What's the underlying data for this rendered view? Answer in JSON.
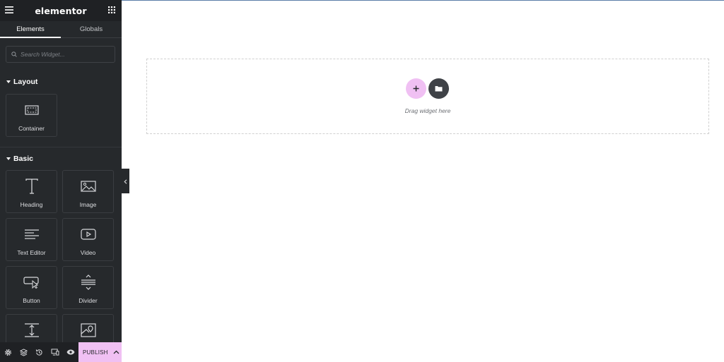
{
  "app": {
    "brand": "elementor"
  },
  "tabs": [
    {
      "label": "Elements",
      "active": true
    },
    {
      "label": "Globals",
      "active": false
    }
  ],
  "search": {
    "placeholder": "Search Widget..."
  },
  "sections": {
    "layout": {
      "title": "Layout",
      "widgets": [
        {
          "label": "Container",
          "icon": "container-icon"
        }
      ]
    },
    "basic": {
      "title": "Basic",
      "widgets": [
        {
          "label": "Heading",
          "icon": "heading-icon"
        },
        {
          "label": "Image",
          "icon": "image-icon"
        },
        {
          "label": "Text Editor",
          "icon": "text-editor-icon"
        },
        {
          "label": "Video",
          "icon": "video-icon"
        },
        {
          "label": "Button",
          "icon": "button-icon"
        },
        {
          "label": "Divider",
          "icon": "divider-icon"
        },
        {
          "label": "",
          "icon": "spacer-icon"
        },
        {
          "label": "",
          "icon": "google-maps-icon"
        }
      ]
    }
  },
  "bottombar": {
    "icons": [
      "settings-icon",
      "layers-icon",
      "history-icon",
      "responsive-icon",
      "preview-icon"
    ],
    "publish_label": "PUBLISH"
  },
  "canvas": {
    "drop_text": "Drag widget here"
  },
  "colors": {
    "sidebar_bg": "#26292c",
    "accent_pink": "#f0c0f3",
    "dark_button": "#3f4247"
  }
}
